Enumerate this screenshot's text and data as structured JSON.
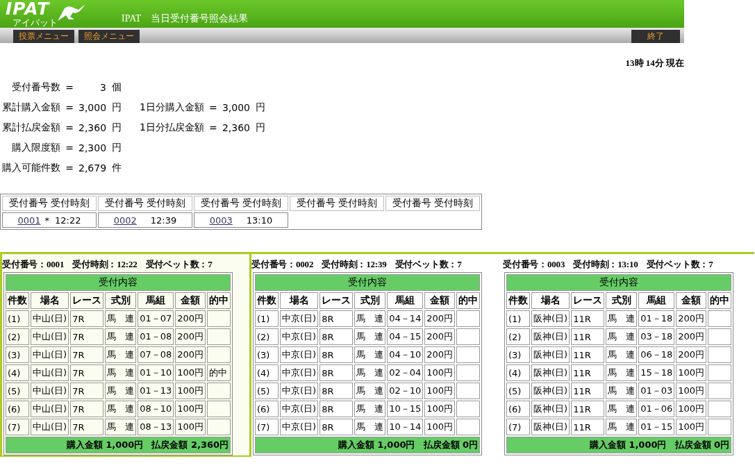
{
  "header": {
    "logo": "IPAT",
    "logo_sub": "アイパット",
    "title": "IPAT　当日受付番号照会結果"
  },
  "nav": [
    {
      "label": "投票メニュー"
    },
    {
      "label": "照会メニュー"
    }
  ],
  "exit_button": "終了",
  "current_time": "13時 14分 現在",
  "summary": [
    {
      "items": [
        {
          "label": "受付番号数",
          "eq": "=",
          "value": "3",
          "unit": "個"
        }
      ]
    },
    {
      "items": [
        {
          "label": "累計購入金額",
          "eq": "=",
          "value": "3,000",
          "unit": "円"
        },
        {
          "label": "1日分購入金額",
          "eq": "=",
          "value": "3,000",
          "unit": "円"
        }
      ]
    },
    {
      "items": [
        {
          "label": "累計払戻金額",
          "eq": "=",
          "value": "2,360",
          "unit": "円"
        },
        {
          "label": "1日分払戻金額",
          "eq": "=",
          "value": "2,360",
          "unit": "円"
        }
      ]
    },
    {
      "items": [
        {
          "label": "購入限度額",
          "eq": "=",
          "value": "2,300",
          "unit": "円"
        }
      ]
    },
    {
      "items": [
        {
          "label": "購入可能件数",
          "eq": "=",
          "value": "2,679",
          "unit": "件"
        }
      ]
    }
  ],
  "receipts": {
    "columns": [
      {
        "number_heading": "受付番号",
        "time_heading": "受付時刻"
      },
      {
        "number_heading": "受付番号",
        "time_heading": "受付時刻"
      },
      {
        "number_heading": "受付番号",
        "time_heading": "受付時刻"
      },
      {
        "number_heading": "受付番号",
        "time_heading": "受付時刻"
      },
      {
        "number_heading": "受付番号",
        "time_heading": "受付時刻"
      }
    ],
    "cells": [
      {
        "number": "0001",
        "mark": "*",
        "time": "12:22"
      },
      {
        "number": "0002",
        "time": "12:39"
      },
      {
        "number": "0003",
        "time": "13:10"
      }
    ]
  },
  "bets": [
    {
      "selected": true,
      "number": "受付番号：0001",
      "time": "受付時刻：12:22",
      "count": "受付ベット数：7",
      "caption": "受付内容",
      "columns": [
        "件数",
        "場名",
        "レース",
        "式別",
        "馬組",
        "金額",
        "的中"
      ],
      "rows": [
        {
          "no": "(1)",
          "venue": "中山(日)",
          "race": "7R",
          "type": "馬　連",
          "combo": "01－07",
          "amount": "200円"
        },
        {
          "no": "(2)",
          "venue": "中山(日)",
          "race": "7R",
          "type": "馬　連",
          "combo": "01－08",
          "amount": "200円"
        },
        {
          "no": "(3)",
          "venue": "中山(日)",
          "race": "7R",
          "type": "馬　連",
          "combo": "07－08",
          "amount": "200円"
        },
        {
          "no": "(4)",
          "venue": "中山(日)",
          "race": "7R",
          "type": "馬　連",
          "combo": "01－10",
          "amount": "100円",
          "hit": "的中"
        },
        {
          "no": "(5)",
          "venue": "中山(日)",
          "race": "7R",
          "type": "馬　連",
          "combo": "01－13",
          "amount": "100円"
        },
        {
          "no": "(6)",
          "venue": "中山(日)",
          "race": "7R",
          "type": "馬　連",
          "combo": "08－10",
          "amount": "100円"
        },
        {
          "no": "(7)",
          "venue": "中山(日)",
          "race": "7R",
          "type": "馬　連",
          "combo": "08－13",
          "amount": "100円"
        }
      ],
      "purchase_total": "購入金額 1,000円",
      "payout_total": "払戻金額 2,360円"
    },
    {
      "selected": false,
      "number": "受付番号：0002",
      "time": "受付時刻：12:39",
      "count": "受付ベット数：7",
      "caption": "受付内容",
      "columns": [
        "件数",
        "場名",
        "レース",
        "式別",
        "馬組",
        "金額",
        "的中"
      ],
      "rows": [
        {
          "no": "(1)",
          "venue": "中京(日)",
          "race": "8R",
          "type": "馬　連",
          "combo": "04－14",
          "amount": "200円"
        },
        {
          "no": "(2)",
          "venue": "中京(日)",
          "race": "8R",
          "type": "馬　連",
          "combo": "04－15",
          "amount": "200円"
        },
        {
          "no": "(3)",
          "venue": "中京(日)",
          "race": "8R",
          "type": "馬　連",
          "combo": "04－10",
          "amount": "200円"
        },
        {
          "no": "(4)",
          "venue": "中京(日)",
          "race": "8R",
          "type": "馬　連",
          "combo": "02－04",
          "amount": "100円"
        },
        {
          "no": "(5)",
          "venue": "中京(日)",
          "race": "8R",
          "type": "馬　連",
          "combo": "02－10",
          "amount": "100円"
        },
        {
          "no": "(6)",
          "venue": "中京(日)",
          "race": "8R",
          "type": "馬　連",
          "combo": "10－15",
          "amount": "100円"
        },
        {
          "no": "(7)",
          "venue": "中京(日)",
          "race": "8R",
          "type": "馬　連",
          "combo": "10－14",
          "amount": "100円"
        }
      ],
      "purchase_total": "購入金額 1,000円",
      "payout_total": "払戻金額 0円"
    },
    {
      "selected": false,
      "number": "受付番号：0003",
      "time": "受付時刻：13:10",
      "count": "受付ベット数：7",
      "caption": "受付内容",
      "columns": [
        "件数",
        "場名",
        "レース",
        "式別",
        "馬組",
        "金額",
        "的中"
      ],
      "rows": [
        {
          "no": "(1)",
          "venue": "阪神(日)",
          "race": "11R",
          "type": "馬　連",
          "combo": "01－18",
          "amount": "200円"
        },
        {
          "no": "(2)",
          "venue": "阪神(日)",
          "race": "11R",
          "type": "馬　連",
          "combo": "03－18",
          "amount": "200円"
        },
        {
          "no": "(3)",
          "venue": "阪神(日)",
          "race": "11R",
          "type": "馬　連",
          "combo": "06－18",
          "amount": "200円"
        },
        {
          "no": "(4)",
          "venue": "阪神(日)",
          "race": "11R",
          "type": "馬　連",
          "combo": "15－18",
          "amount": "100円"
        },
        {
          "no": "(5)",
          "venue": "阪神(日)",
          "race": "11R",
          "type": "馬　連",
          "combo": "01－03",
          "amount": "100円"
        },
        {
          "no": "(6)",
          "venue": "阪神(日)",
          "race": "11R",
          "type": "馬　連",
          "combo": "01－06",
          "amount": "100円"
        },
        {
          "no": "(7)",
          "venue": "阪神(日)",
          "race": "11R",
          "type": "馬　連",
          "combo": "01－15",
          "amount": "100円"
        }
      ],
      "purchase_total": "購入金額 1,000円",
      "payout_total": "払戻金額 0円"
    }
  ]
}
